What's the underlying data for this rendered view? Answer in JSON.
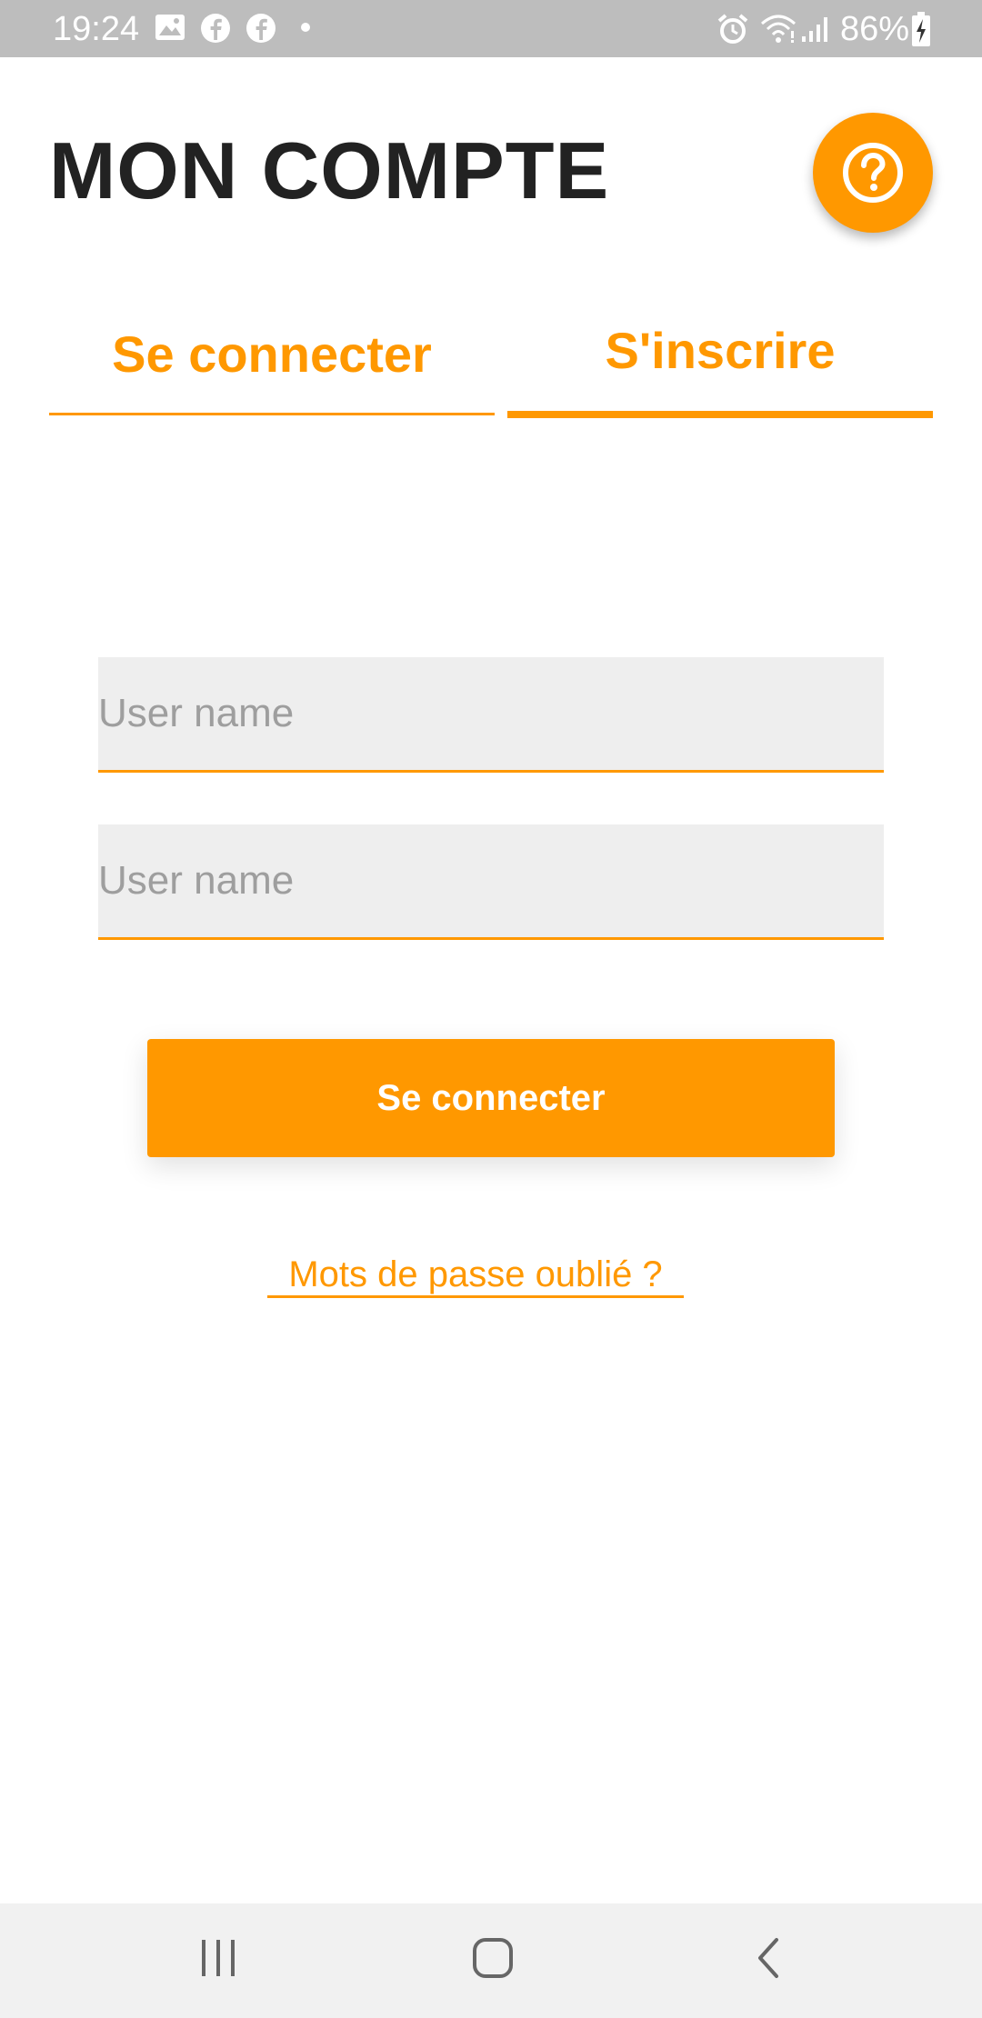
{
  "status_bar": {
    "time": "19:24",
    "battery": "86%",
    "icons": [
      "image-icon",
      "facebook-icon",
      "facebook-icon",
      "dot-icon",
      "alarm-icon",
      "wifi-icon",
      "signal-icon",
      "battery-charging-icon"
    ]
  },
  "header": {
    "title": "MON COMPTE",
    "help_icon": "help-circle-icon"
  },
  "tabs": [
    {
      "label": "Se connecter",
      "active": false
    },
    {
      "label": "S'inscrire",
      "active": true
    }
  ],
  "form": {
    "field1_placeholder": "User name",
    "field1_value": "",
    "field2_placeholder": "User name",
    "field2_value": "",
    "submit_label": "Se connecter",
    "forgot_label": "Mots de passe oublié ?"
  },
  "nav_bar": {
    "icons": [
      "recent-apps-icon",
      "home-icon",
      "back-icon"
    ]
  },
  "colors": {
    "accent": "#ff9800",
    "title": "#222222",
    "field_background": "#eeeeee",
    "status_bar": "#bdbdbd",
    "nav_bar": "#f1f1f1"
  }
}
